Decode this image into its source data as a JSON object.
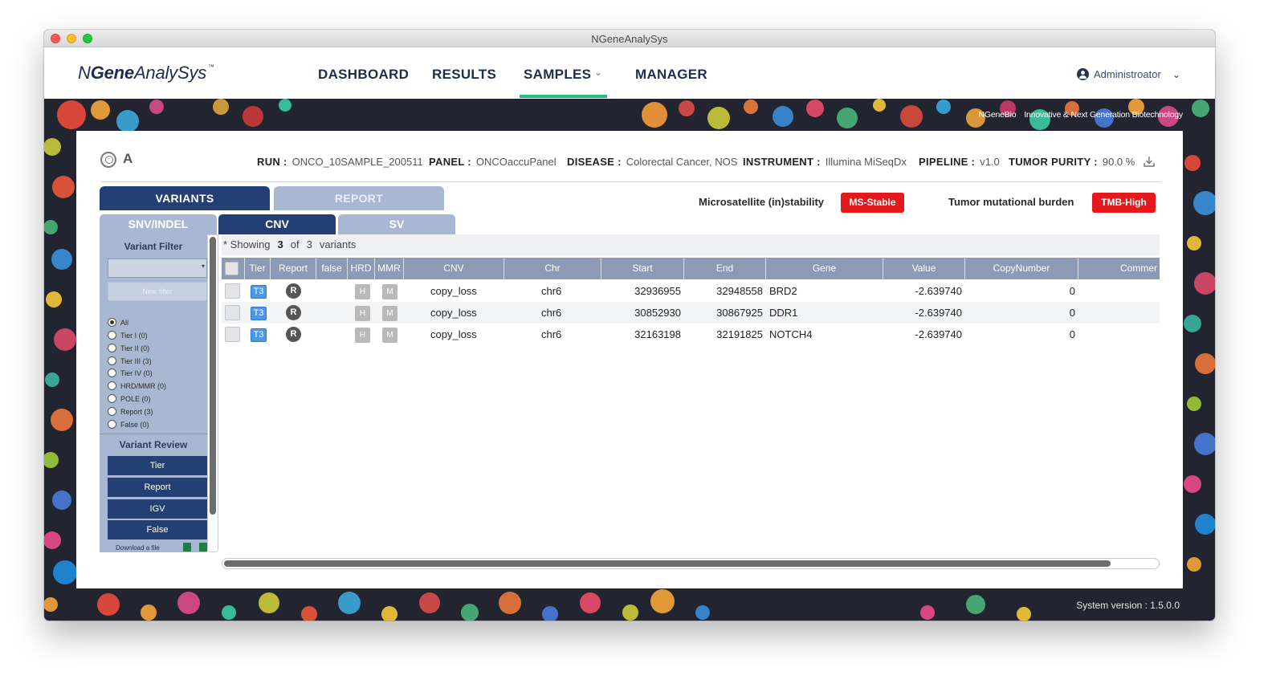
{
  "window": {
    "title": "NGeneAnalySys"
  },
  "nav": {
    "logo_prefix": "N",
    "logo_bold": "Gene",
    "logo_suffix": "AnalySys",
    "logo_tm": "™",
    "items": [
      "DASHBOARD",
      "RESULTS",
      "SAMPLES",
      "MANAGER"
    ],
    "active": "SAMPLES",
    "user": "Administroator"
  },
  "brand": {
    "company": "NGeneBio",
    "tagline": "Innovative & Next Generation Biotechnology"
  },
  "system_version": "System version : 1.5.0.0",
  "sample": {
    "name": "A",
    "run_label": "RUN :",
    "run": "ONCO_10SAMPLE_200511",
    "panel_label": "PANEL :",
    "panel": "ONCOaccuPanel",
    "disease_label": "DISEASE :",
    "disease": "Colorectal Cancer, NOS",
    "instrument_label": "INSTRUMENT :",
    "instrument": "Illumina MiSeqDx",
    "pipeline_label": "PIPELINE :",
    "pipeline": "v1.0",
    "purity_label": "TUMOR PURITY :",
    "purity": "90.0 %"
  },
  "tabs": {
    "variants": "VARIANTS",
    "report": "REPORT"
  },
  "subtabs": {
    "snv": "SNV/INDEL",
    "cnv": "CNV",
    "sv": "SV"
  },
  "biomarkers": {
    "msi_label": "Microsatellite (in)stability",
    "msi_value": "MS-Stable",
    "tmb_label": "Tumor mutational burden",
    "tmb_value": "TMB-High",
    "badge_color": "#e5191c"
  },
  "sidebar": {
    "filter_title": "Variant Filter",
    "new_filter": "New filter",
    "radios": [
      "All",
      "Tier I (0)",
      "Tier II (0)",
      "Tier III (3)",
      "Tier IV (0)",
      "HRD/MMR (0)",
      "POLE (0)",
      "Report (3)",
      "False (0)"
    ],
    "selected_radio": "All",
    "review_title": "Variant Review",
    "review_buttons": [
      "Tier",
      "Report",
      "IGV",
      "False"
    ],
    "download": "Download a file"
  },
  "grid": {
    "showing_prefix": "* Showing",
    "showing_count": "3",
    "showing_of": "of",
    "showing_total": "3",
    "showing_suffix": "variants",
    "columns": [
      "Tier",
      "Report",
      "false",
      "HRD",
      "MMR",
      "CNV",
      "Chr",
      "Start",
      "End",
      "Gene",
      "Value",
      "CopyNumber",
      "Commer"
    ],
    "rows": [
      {
        "tier": "T3",
        "report": "R",
        "hrd": "H",
        "mmr": "M",
        "cnv": "copy_loss",
        "chr": "chr6",
        "start": "32936955",
        "end": "32948558",
        "gene": "BRD2",
        "value": "-2.639740",
        "copynumber": "0"
      },
      {
        "tier": "T3",
        "report": "R",
        "hrd": "H",
        "mmr": "M",
        "cnv": "copy_loss",
        "chr": "chr6",
        "start": "30852930",
        "end": "30867925",
        "gene": "DDR1",
        "value": "-2.639740",
        "copynumber": "0"
      },
      {
        "tier": "T3",
        "report": "R",
        "hrd": "H",
        "mmr": "M",
        "cnv": "copy_loss",
        "chr": "chr6",
        "start": "32163198",
        "end": "32191825",
        "gene": "NOTCH4",
        "value": "-2.639740",
        "copynumber": "0"
      }
    ]
  },
  "colors": {
    "navy": "#233f73",
    "accent_green": "#1fbe7e",
    "light_blue": "#a9b8d2",
    "tier_blue": "#4c97e6"
  }
}
